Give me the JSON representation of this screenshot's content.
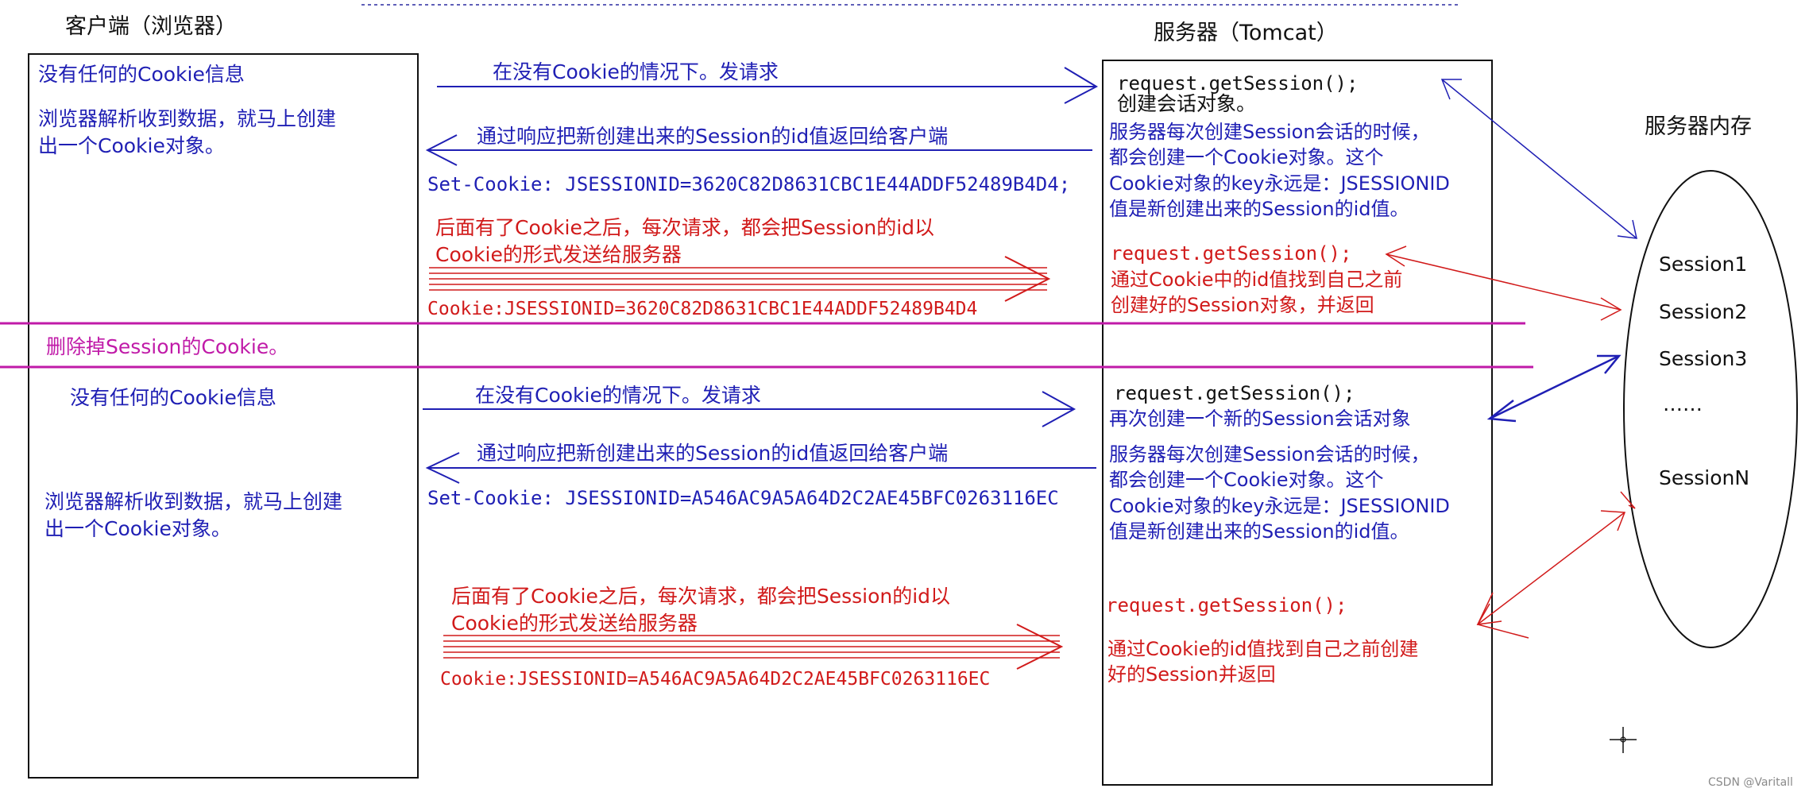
{
  "headers": {
    "client": "客户端（浏览器）",
    "server": "服务器（Tomcat）",
    "memory": "服务器内存"
  },
  "top": {
    "client_no_cookie": "没有任何的Cookie信息",
    "client_parse": "浏览器解析收到数据，就马上创建\n出一个Cookie对象。",
    "request_label": "在没有Cookie的情况下。发请求",
    "response_label": "通过响应把新创建出来的Session的id值返回给客户端",
    "set_cookie": "Set-Cookie: JSESSIONID=3620C82D8631CBC1E44ADDF52489B4D4;",
    "later_label": "后面有了Cookie之后，每次请求，都会把Session的id以\nCookie的形式发送给服务器",
    "cookie_header": "Cookie:JSESSIONID=3620C82D8631CBC1E44ADDF52489B4D4",
    "server_call1": "request.getSession();",
    "server_create": "创建会话对象。",
    "server_desc": "服务器每次创建Session会话的时候，\n都会创建一个Cookie对象。这个\nCookie对象的key永远是：JSESSIONID\n值是新创建出来的Session的id值。",
    "server_call2": "request.getSession();",
    "server_find": "通过Cookie中的id值找到自己之前\n创建好的Session对象，并返回"
  },
  "divider": {
    "label": "删除掉Session的Cookie。"
  },
  "bottom": {
    "client_no_cookie": "没有任何的Cookie信息",
    "client_parse": "浏览器解析收到数据，就马上创建\n出一个Cookie对象。",
    "request_label": "在没有Cookie的情况下。发请求",
    "response_label": "通过响应把新创建出来的Session的id值返回给客户端",
    "set_cookie": "Set-Cookie: JSESSIONID=A546AC9A5A64D2C2AE45BFC0263116EC",
    "later_label": "后面有了Cookie之后，每次请求，都会把Session的id以\nCookie的形式发送给服务器",
    "cookie_header": "Cookie:JSESSIONID=A546AC9A5A64D2C2AE45BFC0263116EC",
    "server_call1": "request.getSession();",
    "server_recreate": "再次创建一个新的Session会话对象",
    "server_desc": "服务器每次创建Session会话的时候，\n都会创建一个Cookie对象。这个\nCookie对象的key永远是：JSESSIONID\n值是新创建出来的Session的id值。",
    "server_call2": "request.getSession();",
    "server_find": "通过Cookie的id值找到自己之前创建\n好的Session并返回"
  },
  "memory": {
    "sessions": [
      "Session1",
      "Session2",
      "Session3",
      "……",
      "SessionN"
    ]
  },
  "watermark": "CSDN @Varitall",
  "colors": {
    "blue": "#1f1fb4",
    "red": "#d11a1a",
    "magenta": "#c01aa8",
    "black": "#111111"
  }
}
